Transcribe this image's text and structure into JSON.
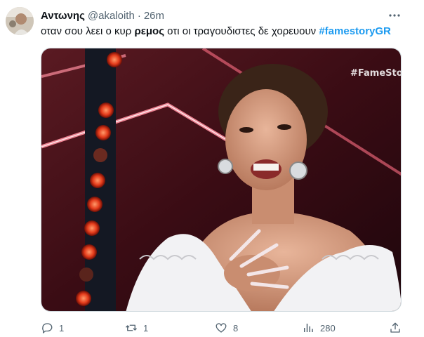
{
  "tweet": {
    "author_name": "Αντωνης",
    "handle": "@akaloith",
    "separator": "·",
    "time": "26m",
    "text": {
      "part1": "οταν σου λεει ο κυρ ",
      "bold": "ρεμος",
      "part2": " οτι οι τραγουδιστες δε χορευουν ",
      "hashtag": "#famestoryGR"
    },
    "media": {
      "watermark": "#FameStor"
    },
    "actions": {
      "replies": "1",
      "reposts": "1",
      "likes": "8",
      "views": "280"
    },
    "colors": {
      "accent": "#1d9bf0",
      "muted": "#536471",
      "text": "#0f1419"
    },
    "icons": [
      "more-icon",
      "reply-icon",
      "repost-icon",
      "like-icon",
      "views-icon",
      "share-icon"
    ]
  }
}
